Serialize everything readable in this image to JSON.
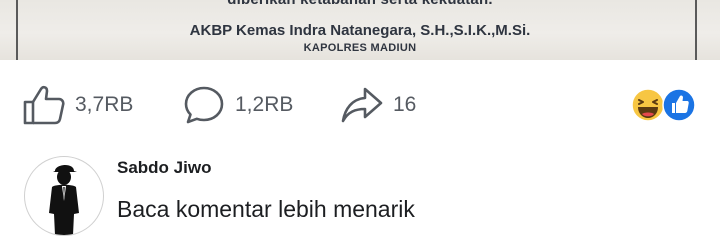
{
  "post_image": {
    "cut_text": "diberikan ketabahan serta kekuatan.",
    "officer_name": "AKBP Kemas Indra Natanegara, S.H.,S.I.K.,M.Si.",
    "officer_title": "KAPOLRES MADIUN"
  },
  "actions": {
    "like": {
      "icon": "thumbs-up-icon",
      "count": "3,7RB"
    },
    "comment": {
      "icon": "comment-bubble-icon",
      "count": "1,2RB"
    },
    "share": {
      "icon": "share-arrow-icon",
      "count": "16"
    },
    "reactions": [
      "haha-reaction-icon",
      "like-reaction-icon"
    ]
  },
  "comment": {
    "author": "Sabdo Jiwo",
    "text": "Baca komentar lebih menarik"
  },
  "colors": {
    "text_secondary": "#555a61",
    "text_primary": "#1c1e21",
    "like_blue": "#1b74e4",
    "haha_yellow": "#f7c643"
  }
}
